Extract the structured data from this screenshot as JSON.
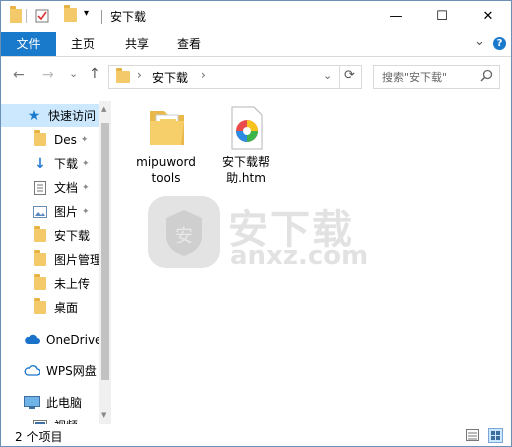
{
  "window": {
    "title": "安下载",
    "controls": {
      "minimize": "—",
      "maximize": "☐",
      "close": "✕"
    }
  },
  "ribbon": {
    "tabs": [
      {
        "label": "文件",
        "active": true
      },
      {
        "label": "主页"
      },
      {
        "label": "共享"
      },
      {
        "label": "查看"
      }
    ],
    "collapse_glyph": "⌄",
    "help_glyph": "?"
  },
  "address": {
    "back": "←",
    "forward": "→",
    "recent": "⌄",
    "up": "↑",
    "path": [
      "安下载"
    ],
    "separator": "›",
    "refresh": "⟳",
    "dropdown": "⌄",
    "search_placeholder": "搜索\"安下载\"",
    "search_icon": "search-icon"
  },
  "nav": {
    "items": [
      {
        "label": "快速访问",
        "icon": "star-icon"
      },
      {
        "label": "Des",
        "icon": "folder-icon",
        "pinned": true
      },
      {
        "label": "下载",
        "icon": "download-icon",
        "pinned": true
      },
      {
        "label": "文档",
        "icon": "document-icon",
        "pinned": true
      },
      {
        "label": "图片",
        "icon": "picture-icon",
        "pinned": true
      },
      {
        "label": "安下载",
        "icon": "folder-icon"
      },
      {
        "label": "图片管理",
        "icon": "folder-icon"
      },
      {
        "label": "未上传",
        "icon": "folder-icon"
      },
      {
        "label": "桌面",
        "icon": "folder-icon"
      },
      {
        "label": "OneDrive",
        "icon": "cloud-icon"
      },
      {
        "label": "WPS网盘",
        "icon": "cloud-outline-icon"
      },
      {
        "label": "此电脑",
        "icon": "computer-icon"
      },
      {
        "label": "视频",
        "icon": "video-icon"
      }
    ]
  },
  "files": [
    {
      "name": "mipuword tools",
      "line1": "mipuword",
      "line2": "tools",
      "icon": "folder-icon"
    },
    {
      "name": "安下载帮助.htm",
      "line1": "安下载帮",
      "line2": "助.htm",
      "icon": "htm-file-icon"
    }
  ],
  "watermark": {
    "text": "安下载",
    "sub": "anxz.com",
    "badge": "安"
  },
  "status": {
    "count_text": "2 个项目"
  },
  "colors": {
    "accent": "#1979ca",
    "folder": "#f3c969",
    "selected_bg": "#cce8ff"
  }
}
